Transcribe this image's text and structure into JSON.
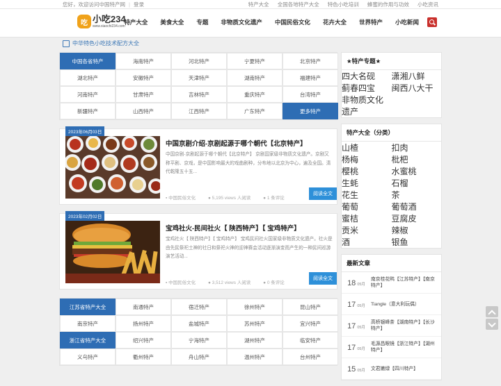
{
  "topbar": {
    "welcome": "您好，欢迎访问中国特产网",
    "login": "登录",
    "links": [
      "特产大全",
      "全国各地特产大全",
      "特色小吃培训",
      "蜂蜜的作用与功效",
      "小吃资讯"
    ]
  },
  "logo": {
    "mark": "吃",
    "text": "小吃234",
    "url": "www.xiaochi234.com"
  },
  "nav": [
    "特产大全",
    "美食大全",
    "专题",
    "非物质文化遗产",
    "中国民俗文化",
    "花卉大全",
    "世界特产",
    "小吃新闻"
  ],
  "breadcrumb": "中华特色小吃技术配方大全",
  "grid1": [
    {
      "label": "中国各省特产",
      "hl": true
    },
    {
      "label": "海南特产"
    },
    {
      "label": "河北特产"
    },
    {
      "label": "宁夏特产"
    },
    {
      "label": "北京特产"
    },
    {
      "label": "湖北特产"
    },
    {
      "label": "安徽特产"
    },
    {
      "label": "天津特产"
    },
    {
      "label": "湖南特产"
    },
    {
      "label": "福建特产"
    },
    {
      "label": "河南特产"
    },
    {
      "label": "甘肃特产"
    },
    {
      "label": "吉林特产"
    },
    {
      "label": "重庆特产"
    },
    {
      "label": "台湾特产"
    },
    {
      "label": "新疆特产"
    },
    {
      "label": "山西特产"
    },
    {
      "label": "江西特产"
    },
    {
      "label": "广东特产"
    },
    {
      "label": "更多特产",
      "hl": true
    }
  ],
  "posts": [
    {
      "date": "2023年06月03日",
      "title": "中国京剧介绍-京剧起源于哪个朝代【北京特产】",
      "excerpt": "中国京剧-京剧起源于哪个朝代【北京特产】 京剧国家级非物质文化遗产。京剧又称平剧、京戏，是中国影响最大的戏曲剧种，分布地以北京为中心，遍及全国。清代乾隆五十五...",
      "category": "中国民俗文化",
      "views": "5,195 views 人阅读",
      "comments": "1 条评论",
      "read": "阅读全文"
    },
    {
      "date": "2023年02月02日",
      "title": "宝鸡社火-民间社火【 陕西特产】【 宝鸡特产】",
      "excerpt": "宝鸡社火【 陕西特产】【 宝鸡特产】 宝鸡民间社火国家级非物质文化遗产。社火是由先民祭祀土神的社日和祭祀火神的迎神赛会活动逐渐演变而产生的一种民间巡游演艺活动...",
      "category": "中国民俗文化",
      "views": "3,512 views 人阅读",
      "comments": "0 条评论",
      "read": "阅读全文"
    }
  ],
  "grid2": [
    {
      "label": "江苏省特产大全",
      "hl": true
    },
    {
      "label": "南通特产"
    },
    {
      "label": "宿迁特产"
    },
    {
      "label": "徐州特产"
    },
    {
      "label": "昆山特产"
    },
    {
      "label": "南京特产"
    },
    {
      "label": "扬州特产"
    },
    {
      "label": "盐城特产"
    },
    {
      "label": "苏州特产"
    },
    {
      "label": "宜兴特产"
    },
    {
      "label": "浙江省特产大全",
      "hl": true
    },
    {
      "label": "绍兴特产"
    },
    {
      "label": "宁海特产"
    },
    {
      "label": "湖州特产"
    },
    {
      "label": "临安特产"
    },
    {
      "label": "义乌特产"
    },
    {
      "label": "衢州特产"
    },
    {
      "label": "舟山特产"
    },
    {
      "label": "温州特产"
    },
    {
      "label": "台州特产"
    }
  ],
  "sidebar": {
    "topics_title": "★特产专题★",
    "topics": [
      "四大名砚",
      "潇湘八鲜",
      "蓟春四宝",
      "闽西八大干",
      "非物质文化遗产"
    ],
    "cat_title": "特产大全（分类）",
    "cats": [
      "山楂",
      "扣肉",
      "杨梅",
      "枇杷",
      "樱桃",
      "水蜜桃",
      "生蚝",
      "石榴",
      "花生",
      "茶",
      "葡萄",
      "葡萄酒",
      "蜜桔",
      "豆腐皮",
      "贡米",
      "辣椒",
      "酒",
      "银鱼"
    ],
    "latest_title": "最新文章",
    "latest": [
      {
        "day": "18",
        "month": "05月",
        "title": "南京桂花鸭【江苏特产】【南京特产】"
      },
      {
        "day": "17",
        "month": "05月",
        "title": "Tiangle（意大利玩偶）"
      },
      {
        "day": "17",
        "month": "05月",
        "title": "高桥银峰茶【湖南特产】【长沙特产】"
      },
      {
        "day": "17",
        "month": "05月",
        "title": "毛源昌眼镜【浙江特产】【湖州特产】"
      },
      {
        "day": "15",
        "month": "05月",
        "title": "文君嫩绿【四川特产】"
      }
    ]
  },
  "colors": {
    "accent": "#2e6db4",
    "read_btn": "#2e90d9",
    "search": "#c9302c",
    "logo": "#f0a21a"
  }
}
